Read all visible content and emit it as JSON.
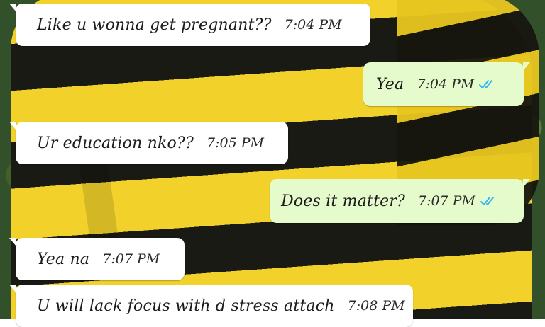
{
  "chat": {
    "messages": [
      {
        "direction": "incoming",
        "text": "Like u wonna get pregnant??",
        "time": "7:04 PM"
      },
      {
        "direction": "outgoing",
        "text": "Yea",
        "time": "7:04 PM",
        "status": "read"
      },
      {
        "direction": "incoming",
        "text": "Ur education nko??",
        "time": "7:05 PM"
      },
      {
        "direction": "outgoing",
        "text": "Does it matter?",
        "time": "7:07 PM",
        "status": "read"
      },
      {
        "direction": "incoming",
        "text": "Yea na",
        "time": "7:07 PM"
      },
      {
        "direction": "incoming",
        "text": "U will lack focus with d stress attach",
        "time": "7:08 PM"
      }
    ]
  },
  "colors": {
    "incoming_bubble": "#ffffff",
    "outgoing_bubble": "#e6fbcc",
    "read_ticks": "#34b7f1",
    "wallpaper_yellow": "#f2d12a",
    "wallpaper_black": "#1a1a14"
  },
  "icons": {
    "read_receipt": "double-check-icon"
  }
}
